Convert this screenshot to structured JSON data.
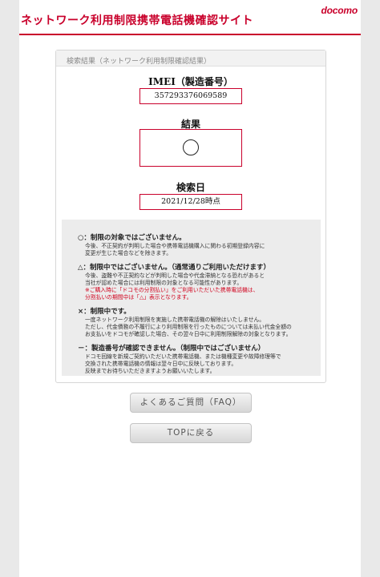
{
  "header": {
    "site_title": "ネットワーク利用制限携帯電話機確認サイト",
    "brand": "docomo"
  },
  "panel": {
    "heading": "検索結果（ネットワーク利用制限確認結果）",
    "imei_label": "IMEI（製造番号）",
    "imei_value": "357293376069589",
    "result_label": "結果",
    "result_symbol": "○",
    "date_label": "検索日",
    "date_value": "2021/12/28時点"
  },
  "notes": [
    {
      "title": "○：制限の対象ではございません。",
      "lines": [
        {
          "text": "今後、不正契約が判明した場合や携帯電話機購入に関わる初期登録内容に",
          "red": false
        },
        {
          "text": "変更が生じた場合などを除きます。",
          "red": false
        }
      ]
    },
    {
      "title": "△：制限中ではございません。（通常通りご利用いただけます）",
      "lines": [
        {
          "text": "今後、盗難や不正契約などが判明した場合や代金滞納となる恐れがあると",
          "red": false
        },
        {
          "text": "当社が認めた場合には利用制限の対象となる可能性があります。",
          "red": false
        },
        {
          "text": "※ご購入時に「ドコモの分割払い」をご利用いただいた携帯電話機は、",
          "red": true
        },
        {
          "text": "分割払いの期間中は「△」表示となります。",
          "red": true
        }
      ]
    },
    {
      "title": "×：制限中です。",
      "lines": [
        {
          "text": "一度ネットワーク利用制限を実施した携帯電話機の解除はいたしません。",
          "red": false
        },
        {
          "text": "ただし、代金債務の不履行により利用制限を行ったものについては未払い代金全額の",
          "red": false
        },
        {
          "text": "お支払いをドコモが確認した場合、その翌々日中に利用制限解除の対象となります。",
          "red": false
        }
      ]
    },
    {
      "title": "－：製造番号が確認できません。（制限中ではございません）",
      "lines": [
        {
          "text": "ドコモ回線を新規ご契約いただいた携帯電話機、または機種変更や故障修理等で",
          "red": false
        },
        {
          "text": "交換された携帯電話機の情報は翌々日中に反映しております。",
          "red": false
        },
        {
          "text": "反映までお待ちいただきますようお願いいたします。",
          "red": false
        }
      ]
    }
  ],
  "buttons": {
    "faq": "よくあるご質問（FAQ）",
    "top": "TOPに戻る"
  }
}
